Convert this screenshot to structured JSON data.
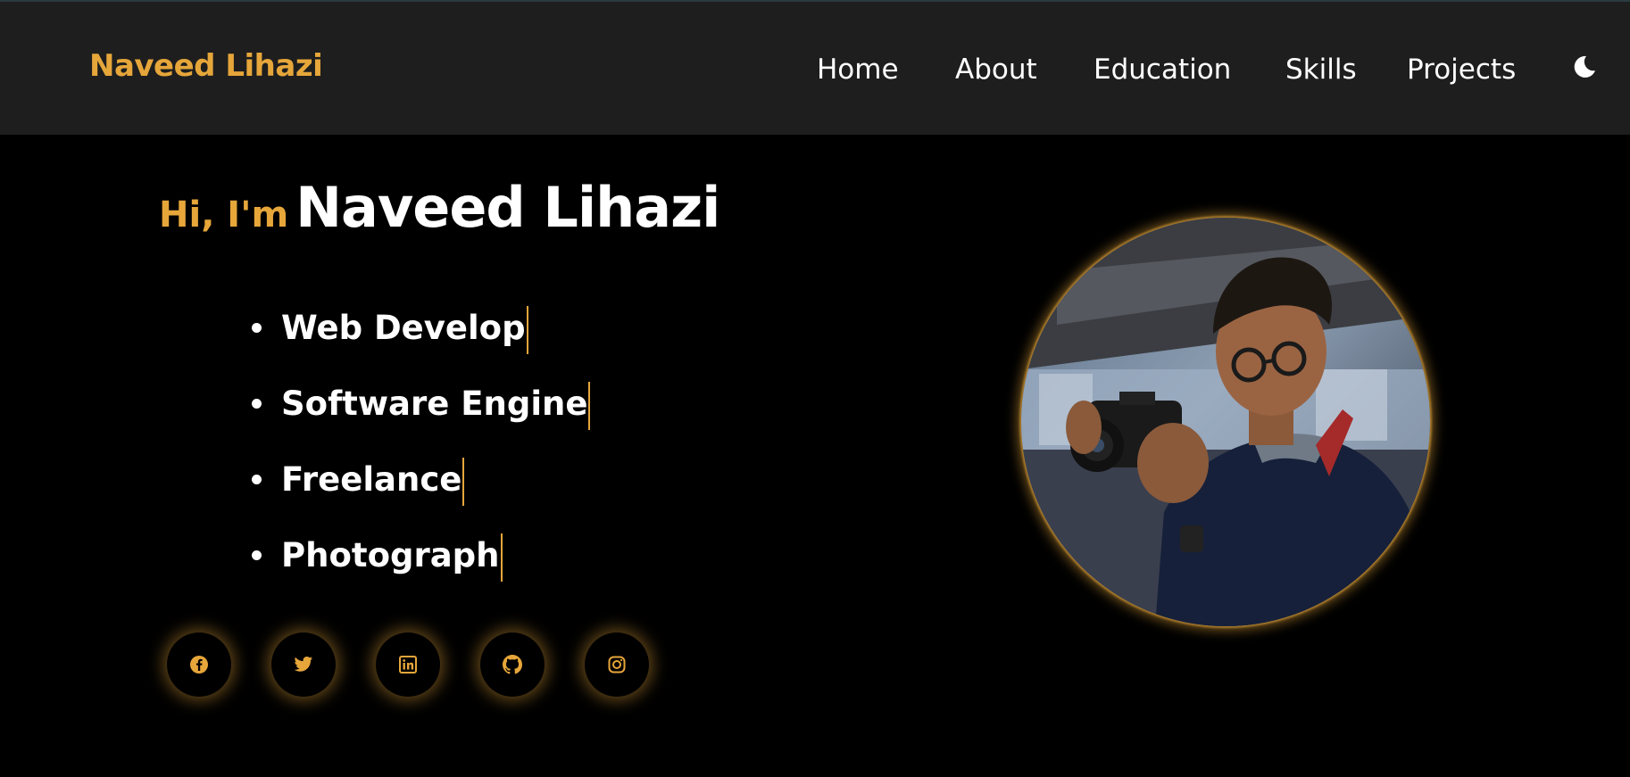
{
  "header": {
    "brand": "Naveed Lihazi",
    "nav": [
      {
        "label": "Home"
      },
      {
        "label": "About"
      },
      {
        "label": "Education"
      },
      {
        "label": "Skills"
      },
      {
        "label": "Projects"
      }
    ],
    "theme_toggle_icon": "moon-icon"
  },
  "hero": {
    "greeting": "Hi, I'm",
    "name": "Naveed Lihazi",
    "roles": [
      {
        "text": "Web Develop"
      },
      {
        "text": "Software Engine"
      },
      {
        "text": "Freelance"
      },
      {
        "text": "Photograph"
      }
    ],
    "socials": [
      {
        "icon": "facebook-icon"
      },
      {
        "icon": "twitter-icon"
      },
      {
        "icon": "linkedin-icon"
      },
      {
        "icon": "github-icon"
      },
      {
        "icon": "instagram-icon"
      }
    ],
    "portrait_icon": "profile-photo"
  },
  "colors": {
    "accent": "#e6a63a",
    "navbar_bg": "#1e1e1e",
    "page_bg": "#000000",
    "text": "#ffffff"
  }
}
